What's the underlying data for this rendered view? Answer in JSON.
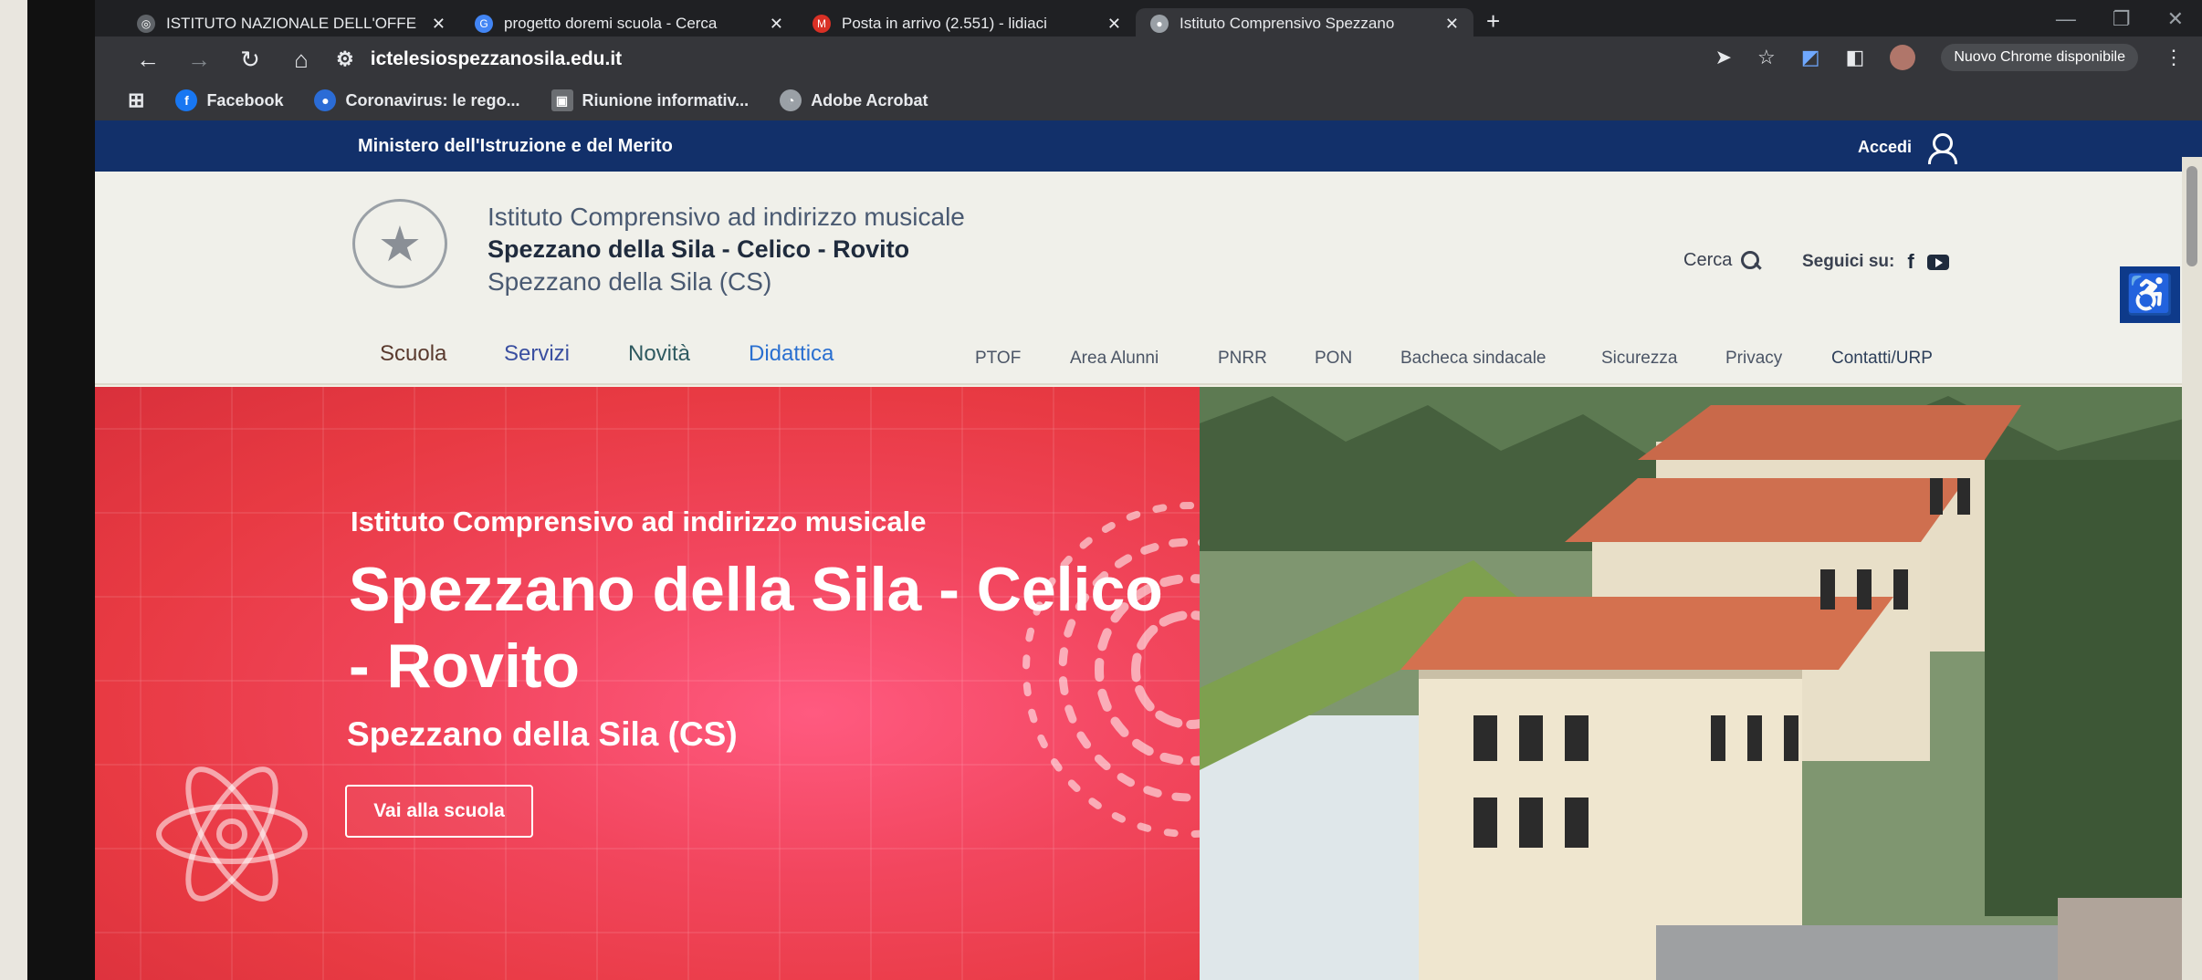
{
  "browser": {
    "tabs": [
      {
        "title": "ISTITUTO NAZIONALE DELL'OFFE",
        "active": false,
        "icon": "globe-icon"
      },
      {
        "title": "progetto doremi scuola - Cerca",
        "active": false,
        "icon": "google-icon"
      },
      {
        "title": "Posta in arrivo (2.551) - lidiaci",
        "active": false,
        "icon": "gmail-icon"
      },
      {
        "title": "Istituto Comprensivo Spezzano",
        "active": true,
        "icon": "school-icon"
      }
    ],
    "url": "ictelesiospezzanosila.edu.it",
    "chrome_pill": "Nuovo Chrome disponibile",
    "bookmarks": [
      {
        "label": "Facebook",
        "icon": "facebook-icon",
        "color": "#1877f2"
      },
      {
        "label": "Coronavirus: le rego...",
        "icon": "gov-icon",
        "color": "#2b6cd6"
      },
      {
        "label": "Riunione informativ...",
        "icon": "meeting-icon",
        "color": "#6b6e72"
      },
      {
        "label": "Adobe Acrobat",
        "icon": "acrobat-icon",
        "color": "#9aa0a6"
      }
    ]
  },
  "site": {
    "ministry": "Ministero dell'Istruzione e del Merito",
    "login": "Accedi",
    "school_line1": "Istituto Comprensivo ad indirizzo musicale",
    "school_line2": "Spezzano della Sila - Celico - Rovito",
    "school_line3": "Spezzano della Sila (CS)",
    "search_label": "Cerca",
    "follow_label": "Seguici su:",
    "main_menu": [
      "Scuola",
      "Servizi",
      "Novità",
      "Didattica"
    ],
    "sub_menu": [
      "PTOF",
      "Area Alunni",
      "PNRR",
      "PON",
      "Bacheca sindacale",
      "Sicurezza",
      "Privacy",
      "Contatti/URP"
    ],
    "hero": {
      "line1": "Istituto Comprensivo ad indirizzo musicale",
      "title": "Spezzano della Sila - Celico - Rovito",
      "line3": "Spezzano della Sila (CS)",
      "button": "Vai alla scuola"
    },
    "colors": {
      "ministry_bar": "#12306a",
      "hero_red": "#e83a43",
      "accessibility": "#0e3a8a"
    }
  }
}
